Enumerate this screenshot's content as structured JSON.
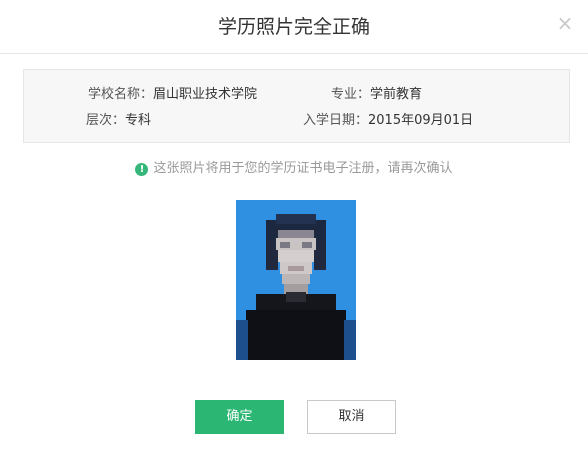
{
  "dialog": {
    "title": "学历照片完全正确",
    "close_icon": "close-icon"
  },
  "info": {
    "school_label": "学校名称：",
    "school_value": "眉山职业技术学院",
    "major_label": "专业：",
    "major_value": "学前教育",
    "level_label": "层次：",
    "level_value": "专科",
    "enroll_label": "入学日期：",
    "enroll_value": "2015年09月01日"
  },
  "notice": {
    "icon": "exclamation-icon",
    "icon_glyph": "!",
    "text": "这张照片将用于您的学历证书电子注册，请再次确认"
  },
  "buttons": {
    "confirm": "确定",
    "cancel": "取消"
  },
  "colors": {
    "primary": "#2bb673",
    "photo_background": "#2f8fe0"
  }
}
